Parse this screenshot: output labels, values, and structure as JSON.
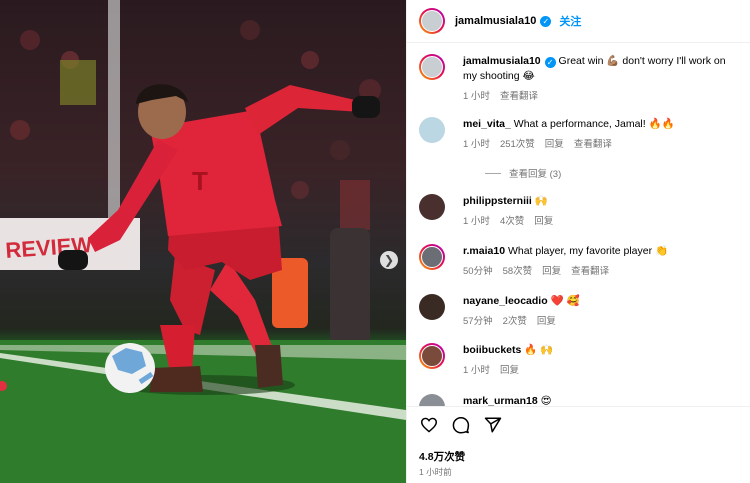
{
  "post": {
    "username": "jamalmusiala10",
    "follow_label": "关注",
    "likes": "4.8万次赞",
    "time_ago": "1 小时前"
  },
  "caption": {
    "username": "jamalmusiala10",
    "text": " Great win 💪🏽 don't worry I'll work on my shooting 😂",
    "time": "1 小时",
    "translate": "查看翻译"
  },
  "comments": [
    {
      "username": "mei_vita_",
      "text": " What a performance, Jamal! 🔥🔥",
      "time": "1 小时",
      "likes": "251次赞",
      "reply": "回复",
      "translate": "查看翻译",
      "view_replies": "查看回复 (3)",
      "avatar_color": "#bcd7e4"
    },
    {
      "username": "philippsterniii",
      "text": " 🙌",
      "time": "1 小时",
      "likes": "4次赞",
      "reply": "回复",
      "avatar_color": "#4a2f2f"
    },
    {
      "username": "r.maia10",
      "text": " What player, my favorite player 👏",
      "time": "50分钟",
      "likes": "58次赞",
      "reply": "回复",
      "translate": "查看翻译",
      "avatar_color": "#6b6f75"
    },
    {
      "username": "nayane_leocadio",
      "text": " ❤️ 🥰",
      "time": "57分钟",
      "likes": "2次赞",
      "reply": "回复",
      "avatar_color": "#3a2a24"
    },
    {
      "username": "boiibuckets",
      "text": " 🔥 🙌",
      "time": "1 小时",
      "reply": "回复",
      "avatar_color": "#7a4a3a"
    },
    {
      "username": "mark_urman18",
      "text": " 😍",
      "avatar_color": "#8a8f96"
    }
  ],
  "colors": {
    "accent": "#0095f6",
    "kit_red": "#d9172a",
    "meta_gray": "#737373"
  },
  "icons": [
    "heart-icon",
    "comment-icon",
    "share-icon",
    "chevron-right-icon",
    "verified-badge-icon"
  ]
}
